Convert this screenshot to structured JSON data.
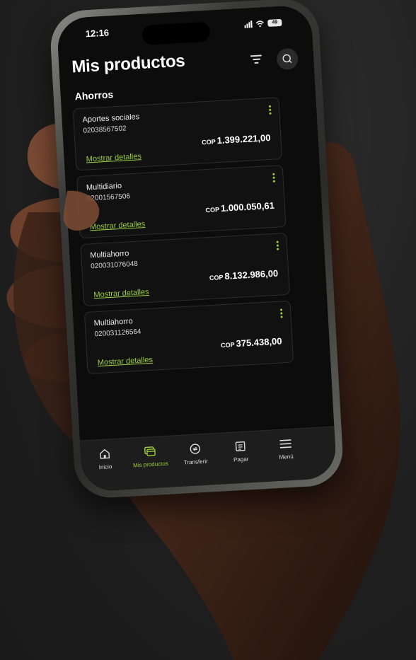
{
  "status": {
    "time": "12:16",
    "battery": "49"
  },
  "header": {
    "title": "Mis productos"
  },
  "section": {
    "title": "Ahorros"
  },
  "cards": [
    {
      "name": "Aportes sociales",
      "number": "02038567502",
      "currency": "COP",
      "balance": "1.399.221,00",
      "link": "Mostrar detalles"
    },
    {
      "name": "Multidiario",
      "number": "02001567506",
      "currency": "COP",
      "balance": "1.000.050,61",
      "link": "Mostrar detalles"
    },
    {
      "name": "Multiahorro",
      "number": "020031076048",
      "currency": "COP",
      "balance": "8.132.986,00",
      "link": "Mostrar detalles"
    },
    {
      "name": "Multiahorro",
      "number": "020031126564",
      "currency": "COP",
      "balance": "375.438,00",
      "link": "Mostrar detalles"
    }
  ],
  "nav": [
    {
      "label": "Inicio",
      "icon": "home-icon"
    },
    {
      "label": "Mis productos",
      "icon": "wallet-icon"
    },
    {
      "label": "Transferir",
      "icon": "transfer-icon"
    },
    {
      "label": "Pagar",
      "icon": "bill-icon"
    },
    {
      "label": "Menú",
      "icon": "menu-icon"
    }
  ],
  "colors": {
    "accent": "#9bcf3b",
    "background": "#0c0c0c"
  }
}
